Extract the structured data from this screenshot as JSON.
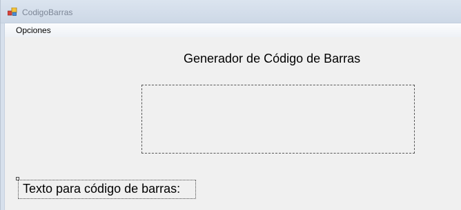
{
  "window": {
    "title": "CodigoBarras",
    "icon": "windows-form-icon"
  },
  "menu": {
    "items": [
      {
        "label": "Opciones"
      }
    ]
  },
  "main": {
    "heading": "Generador de Código de Barras",
    "barcode_area": "",
    "text_label": "Texto para código de barras:"
  },
  "colors": {
    "window_background": "#f0f0f0",
    "titlebar": "#d3ddea",
    "title_text": "#7c8696",
    "text": "#000000"
  }
}
